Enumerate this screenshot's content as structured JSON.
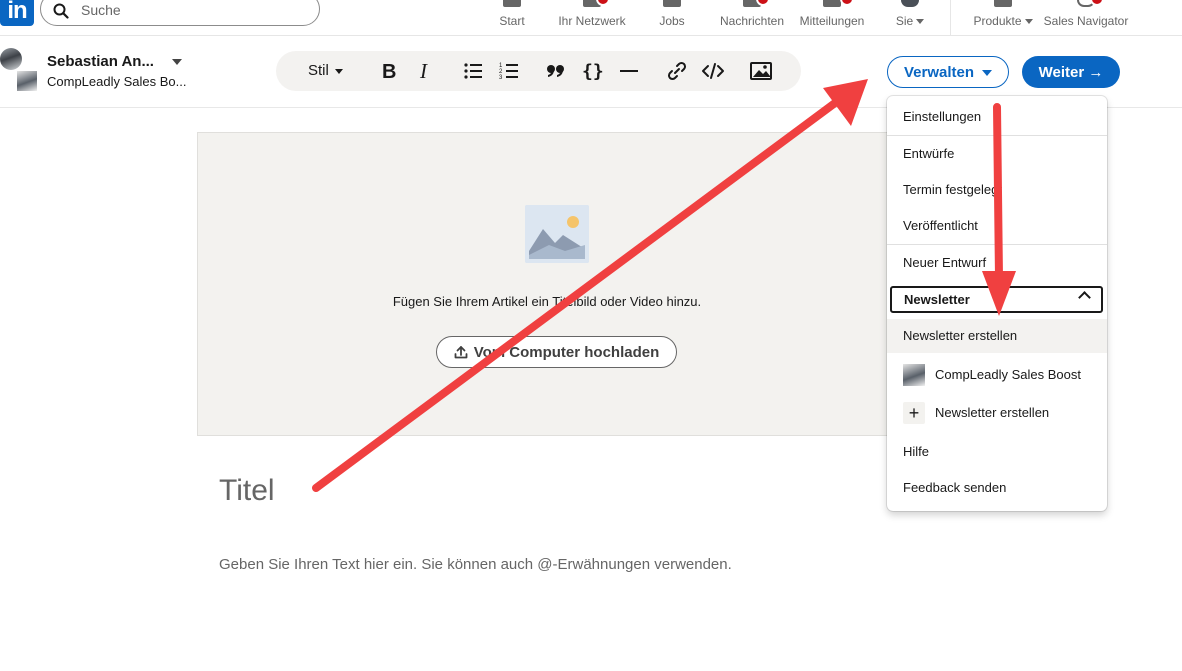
{
  "nav": {
    "logo": "in",
    "search_placeholder": "Suche",
    "items": [
      {
        "label": "Start"
      },
      {
        "label": "Ihr Netzwerk"
      },
      {
        "label": "Jobs"
      },
      {
        "label": "Nachrichten"
      },
      {
        "label": "Mitteilungen"
      },
      {
        "label": "Sie"
      },
      {
        "label": "Produkte"
      },
      {
        "label": "Sales Navigator"
      }
    ]
  },
  "author": {
    "name": "Sebastian An...",
    "page": "CompLeadly Sales Bo..."
  },
  "toolbar": {
    "style_label": "Stil",
    "buttons": [
      "bold-icon",
      "italic-icon",
      "bulleted-list-icon",
      "numbered-list-icon",
      "quote-icon",
      "code-block-icon",
      "divider-icon",
      "link-icon",
      "embed-icon",
      "image-icon"
    ]
  },
  "actions": {
    "manage_label": "Verwalten",
    "next_label": "Weiter →"
  },
  "cover": {
    "prompt": "Fügen Sie Ihrem Artikel ein Titelbild oder Video hinzu.",
    "upload_label": "Vom Computer hochladen"
  },
  "editor": {
    "title_placeholder": "Titel",
    "body_placeholder": "Geben Sie Ihren Text hier ein. Sie können auch @-Erwähnungen verwenden."
  },
  "menu": {
    "settings": "Einstellungen",
    "drafts": "Entwürfe",
    "scheduled": "Termin festgelegt",
    "published": "Veröffentlicht",
    "new_draft": "Neuer Entwurf",
    "newsletter": "Newsletter",
    "create_newsletter": "Newsletter erstellen",
    "company_page": "CompLeadly Sales Boost",
    "create_newsletter_2": "Newsletter erstellen",
    "help": "Hilfe",
    "feedback": "Feedback senden"
  },
  "colors": {
    "brand": "#0a66c2",
    "annotation": "#f04040",
    "notification": "#cc1016"
  }
}
